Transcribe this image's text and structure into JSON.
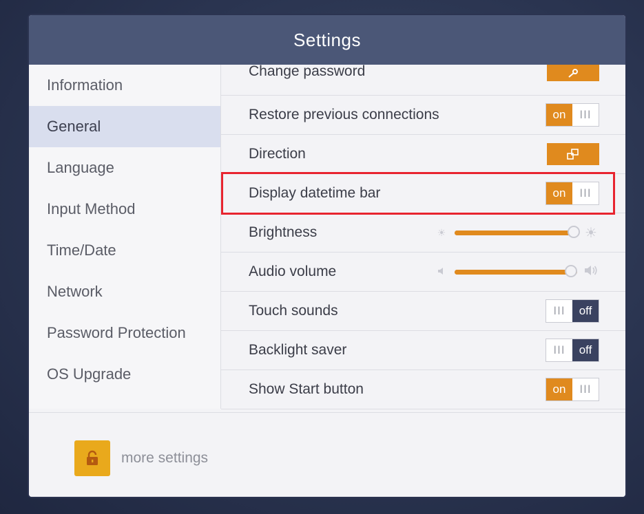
{
  "window": {
    "title": "Settings"
  },
  "sidebar": {
    "items": [
      {
        "label": "Information",
        "active": false
      },
      {
        "label": "General",
        "active": true
      },
      {
        "label": "Language",
        "active": false
      },
      {
        "label": "Input Method",
        "active": false
      },
      {
        "label": "Time/Date",
        "active": false
      },
      {
        "label": "Network",
        "active": false
      },
      {
        "label": "Password Protection",
        "active": false
      },
      {
        "label": "OS Upgrade",
        "active": false
      }
    ]
  },
  "settings": {
    "change_password": {
      "label": "Change password",
      "icon": "key-icon"
    },
    "restore_connections": {
      "label": "Restore previous connections",
      "state": "on",
      "on_text": "on",
      "grip": "III"
    },
    "direction": {
      "label": "Direction",
      "icon": "rotate-screen-icon"
    },
    "display_datetime_bar": {
      "label": "Display datetime bar",
      "state": "on",
      "on_text": "on",
      "grip": "III"
    },
    "brightness": {
      "label": "Brightness",
      "level": 0.97
    },
    "audio_volume": {
      "label": "Audio volume",
      "level": 0.95
    },
    "touch_sounds": {
      "label": "Touch sounds",
      "state": "off",
      "off_text": "off",
      "grip": "III"
    },
    "backlight_saver": {
      "label": "Backlight saver",
      "state": "off",
      "off_text": "off",
      "grip": "III"
    },
    "show_start_button": {
      "label": "Show Start button",
      "state": "on",
      "on_text": "on",
      "grip": "III"
    }
  },
  "footer": {
    "more_settings_label": "more settings",
    "icon": "lock-icon"
  },
  "colors": {
    "accent": "#e08a1e",
    "title_bar": "#4b5777",
    "off_segment": "#3a4260",
    "highlight": "#e8242f",
    "lock": "#e9a91c"
  }
}
